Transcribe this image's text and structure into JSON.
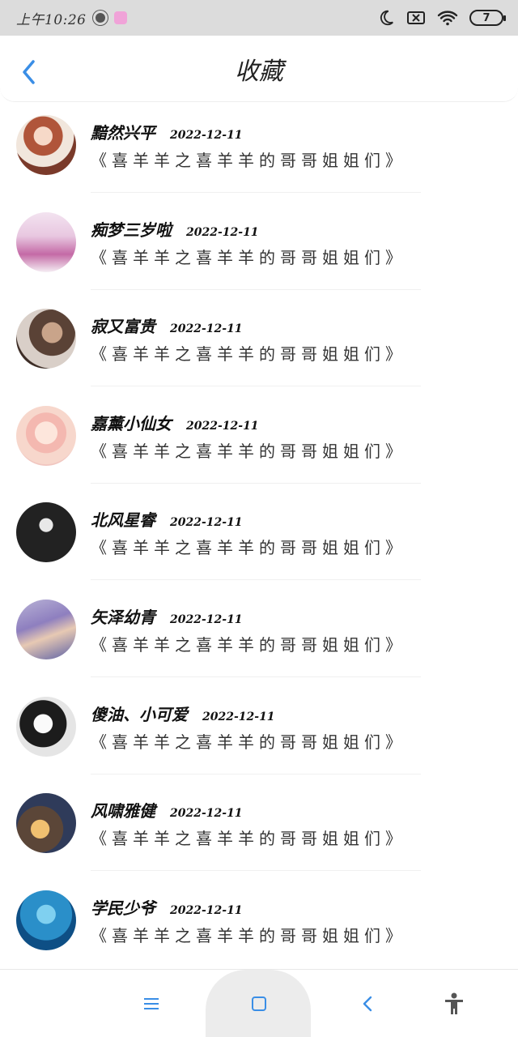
{
  "status": {
    "time": "上午10:26",
    "battery": "7"
  },
  "header": {
    "title": "收藏"
  },
  "items": [
    {
      "name": "黯然兴平",
      "date": "2022-12-11",
      "title": "《喜羊羊之喜羊羊的哥哥姐姐们》"
    },
    {
      "name": "痴梦三岁啦",
      "date": "2022-12-11",
      "title": "《喜羊羊之喜羊羊的哥哥姐姐们》"
    },
    {
      "name": "寂又富贵",
      "date": "2022-12-11",
      "title": "《喜羊羊之喜羊羊的哥哥姐姐们》"
    },
    {
      "name": "嘉薰小仙女",
      "date": "2022-12-11",
      "title": "《喜羊羊之喜羊羊的哥哥姐姐们》"
    },
    {
      "name": "北风星睿",
      "date": "2022-12-11",
      "title": "《喜羊羊之喜羊羊的哥哥姐姐们》"
    },
    {
      "name": "矢泽幼青",
      "date": "2022-12-11",
      "title": "《喜羊羊之喜羊羊的哥哥姐姐们》"
    },
    {
      "name": "傻油、小可爱",
      "date": "2022-12-11",
      "title": "《喜羊羊之喜羊羊的哥哥姐姐们》"
    },
    {
      "name": "风啸雅健",
      "date": "2022-12-11",
      "title": "《喜羊羊之喜羊羊的哥哥姐姐们》"
    },
    {
      "name": "学民少爷",
      "date": "2022-12-11",
      "title": "《喜羊羊之喜羊羊的哥哥姐姐们》"
    }
  ],
  "colors": {
    "accent": "#3a8ee6",
    "status_bar": "#dcdcdc"
  }
}
